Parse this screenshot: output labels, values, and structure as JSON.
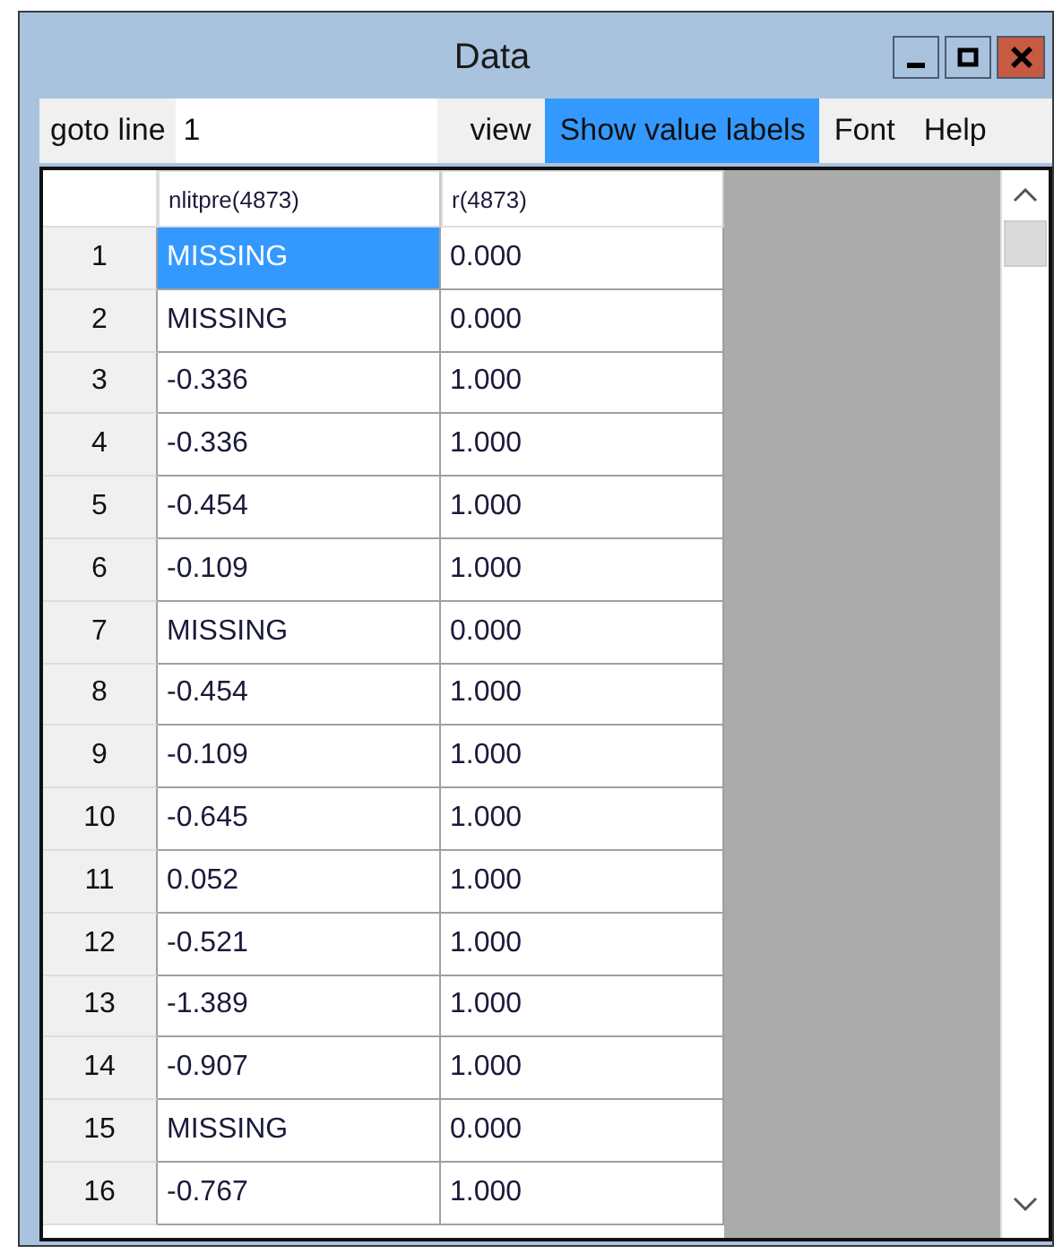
{
  "window": {
    "title": "Data"
  },
  "menu_bar": {
    "goto_label": "goto line",
    "goto_field": {
      "value": "1"
    },
    "items": [
      {
        "label": "view",
        "selected": false
      },
      {
        "label": "Show value labels",
        "selected": true
      },
      {
        "label": "Font",
        "selected": false
      },
      {
        "label": "Help",
        "selected": false
      }
    ]
  },
  "table": {
    "columns": [
      "nlitpre(4873)",
      "r(4873)"
    ],
    "rows": [
      {
        "number": "1",
        "cells": [
          {
            "text": "MISSING",
            "selected": true
          },
          {
            "text": "0.000",
            "selected": false
          }
        ]
      },
      {
        "number": "2",
        "cells": [
          {
            "text": "MISSING",
            "selected": false
          },
          {
            "text": "0.000",
            "selected": false
          }
        ]
      },
      {
        "number": "3",
        "cells": [
          {
            "text": "-0.336",
            "selected": false
          },
          {
            "text": "1.000",
            "selected": false
          }
        ]
      },
      {
        "number": "4",
        "cells": [
          {
            "text": "-0.336",
            "selected": false
          },
          {
            "text": "1.000",
            "selected": false
          }
        ]
      },
      {
        "number": "5",
        "cells": [
          {
            "text": "-0.454",
            "selected": false
          },
          {
            "text": "1.000",
            "selected": false
          }
        ]
      },
      {
        "number": "6",
        "cells": [
          {
            "text": "-0.109",
            "selected": false
          },
          {
            "text": "1.000",
            "selected": false
          }
        ]
      },
      {
        "number": "7",
        "cells": [
          {
            "text": "MISSING",
            "selected": false
          },
          {
            "text": "0.000",
            "selected": false
          }
        ]
      },
      {
        "number": "8",
        "cells": [
          {
            "text": "-0.454",
            "selected": false
          },
          {
            "text": "1.000",
            "selected": false
          }
        ]
      },
      {
        "number": "9",
        "cells": [
          {
            "text": "-0.109",
            "selected": false
          },
          {
            "text": "1.000",
            "selected": false
          }
        ]
      },
      {
        "number": "10",
        "cells": [
          {
            "text": "-0.645",
            "selected": false
          },
          {
            "text": "1.000",
            "selected": false
          }
        ]
      },
      {
        "number": "11",
        "cells": [
          {
            "text": "0.052",
            "selected": false
          },
          {
            "text": "1.000",
            "selected": false
          }
        ]
      },
      {
        "number": "12",
        "cells": [
          {
            "text": "-0.521",
            "selected": false
          },
          {
            "text": "1.000",
            "selected": false
          }
        ]
      },
      {
        "number": "13",
        "cells": [
          {
            "text": "-1.389",
            "selected": false
          },
          {
            "text": "1.000",
            "selected": false
          }
        ]
      },
      {
        "number": "14",
        "cells": [
          {
            "text": "-0.907",
            "selected": false
          },
          {
            "text": "1.000",
            "selected": false
          }
        ]
      },
      {
        "number": "15",
        "cells": [
          {
            "text": "MISSING",
            "selected": false
          },
          {
            "text": "0.000",
            "selected": false
          }
        ]
      },
      {
        "number": "16",
        "cells": [
          {
            "text": "-0.767",
            "selected": false
          },
          {
            "text": "1.000",
            "selected": false
          }
        ]
      }
    ]
  }
}
